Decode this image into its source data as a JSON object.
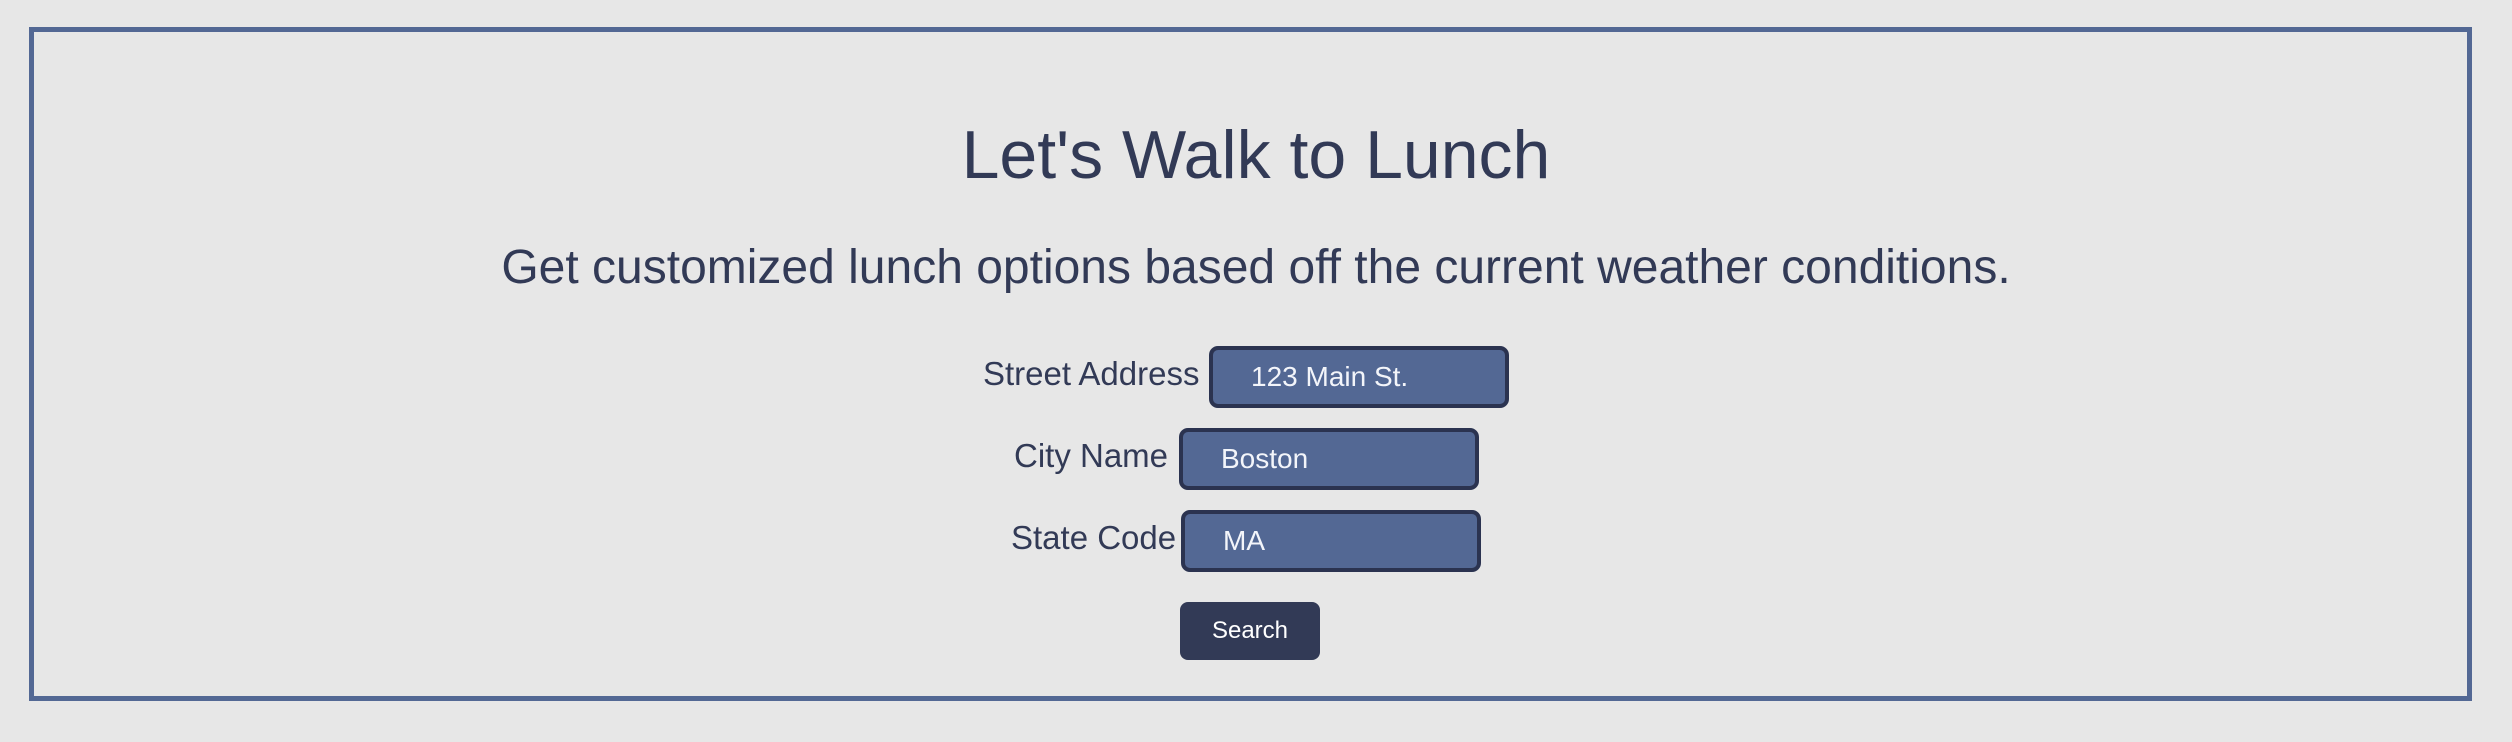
{
  "header": {
    "title": "Let's Walk to Lunch",
    "subtitle": "Get customized lunch options based off the current weather conditions."
  },
  "form": {
    "street": {
      "label": "Street Address",
      "value": "123 Main St."
    },
    "city": {
      "label": "City Name",
      "value": "Boston"
    },
    "state": {
      "label": "State Code",
      "value": "MA"
    },
    "submit_label": "Search"
  },
  "colors": {
    "background": "#e7e7e7",
    "frame_border": "#536894",
    "text": "#323a56",
    "input_fill": "#536894",
    "input_border": "#2b3350",
    "button_fill": "#323a56"
  }
}
